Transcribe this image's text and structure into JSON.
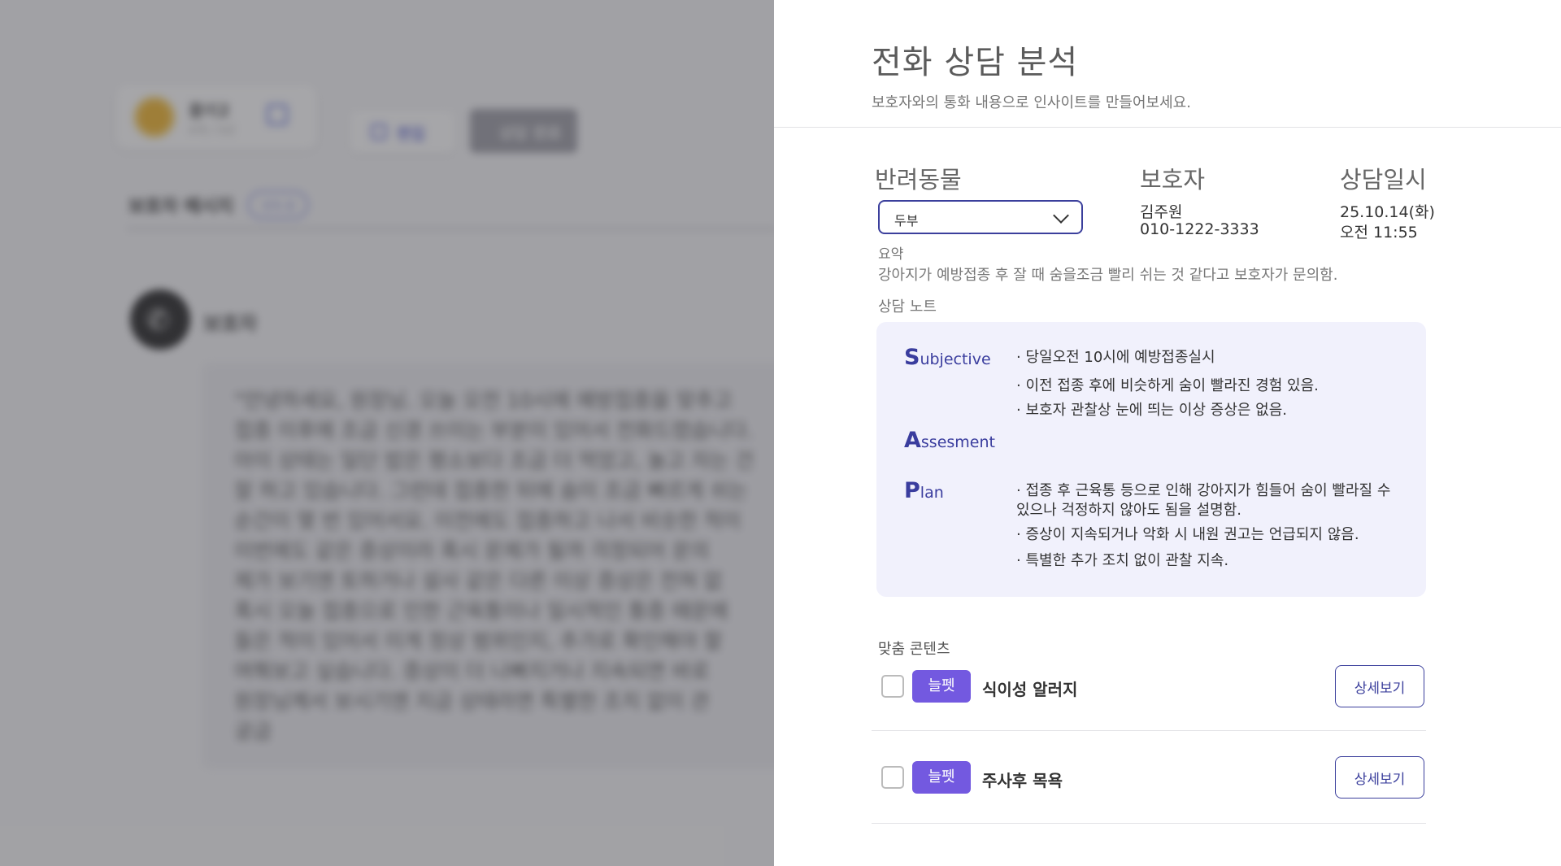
{
  "background": {
    "profile": {
      "name": "품이2",
      "sub": "4개 / 5년"
    },
    "edit_label": "편집",
    "complete_label": "상담 완료",
    "message_title": "보호자 메시지",
    "message_chip": "판독 중",
    "caller_name": "보호자",
    "transcript": "\"안녕하세요, 원장님. 오늘 오전 10시에 예방접종을 맞추고\n접종 이후에 조금 신경 쓰이는 부분이 있어서 전화드렸습니다.\n아이 상태는 일단 밥은 평소보다 조금 더 먹었고, 놀고 자는 건\n잘 하고 있습니다. 그런데 접종한 뒤에 숨이 조금 빠르게 쉬는\n순간이 몇 번 있어서요. 이전에도 접종하고 나서 비슷한 적이\n이번에도 같은 증상이라 혹시 문제가 될까 걱정되어 문의\n제가 보기엔 토하거나 설사 같은 다른 이상 증상은 전혀 없\n혹시 오늘 접종으로 인한 근육통이나 일시적인 통증 때문에\n들은 적이 있어서 이게 정상 범위인지, 추가로 확인해야 할\n여쭤보고 싶습니다. 증상이 더 나빠지거나 지속되면 바로\n원장님께서 보시기엔 지금 상태라면 특별한 조치 없이 관\n궁금"
  },
  "drawer": {
    "title": "전화 상담 분석",
    "subtitle": "보호자와의 통화 내용으로 인사이트를 만들어보세요.",
    "pet": {
      "heading": "반려동물",
      "selected": "두부"
    },
    "guardian": {
      "heading": "보호자",
      "name": "김주원",
      "phone": "010-1222-3333"
    },
    "consult_date": {
      "heading": "상담일시",
      "day": "25.10.14(화)",
      "time": "오전 11:55"
    },
    "summary": {
      "label": "요약",
      "text": "강아지가 예방접종 후 잘 때 숨을조금 빨리 쉬는 것 같다고 보호자가 문의함."
    },
    "note": {
      "label": "상담 노트",
      "subjective": {
        "initial": "S",
        "rest": "ubjective",
        "items": [
          "· 당일오전 10시에 예방접종실시",
          "· 이전 접종 후에 비슷하게 숨이 빨라진 경험 있음.",
          "· 보호자 관찰상 눈에 띄는 이상 증상은 없음."
        ]
      },
      "assessment": {
        "initial": "A",
        "rest": "ssesment"
      },
      "plan": {
        "initial": "P",
        "rest": "lan",
        "items": [
          "· 접종 후 근육통 등으로 인해 강아지가 힘들어 숨이 빨라질 수 있으나 걱정하지 않아도 됨을 설명함.",
          "· 증상이 지속되거나 악화 시 내원 권고는 언급되지 않음.",
          "· 특별한 추가 조치 없이 관찰 지속."
        ]
      }
    },
    "contents": {
      "label": "맞춤 콘텐츠",
      "items": [
        {
          "badge": "늘펫",
          "title": "식이성 알러지",
          "detail_label": "상세보기"
        },
        {
          "badge": "늘펫",
          "title": "주사후 목욕",
          "detail_label": "상세보기"
        }
      ]
    }
  }
}
